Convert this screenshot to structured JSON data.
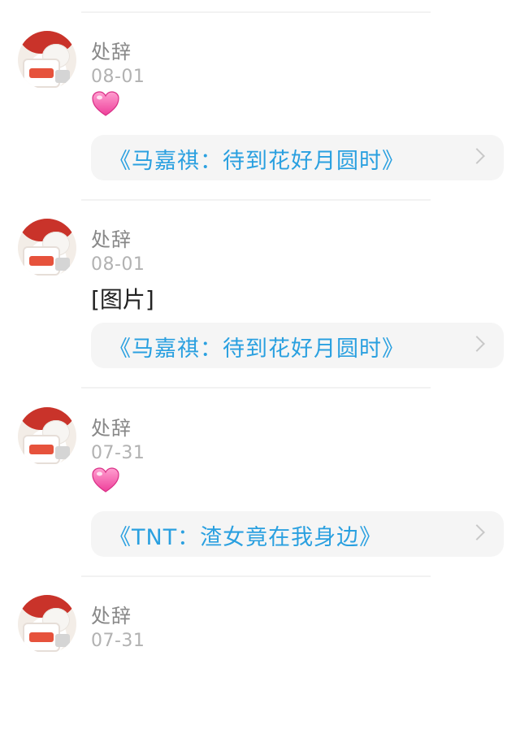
{
  "comments": [
    {
      "user": "处辞",
      "date": "08-01",
      "content_type": "heart-emoji",
      "content_text": "",
      "link": "《马嘉祺：待到花好月圆时》"
    },
    {
      "user": "处辞",
      "date": "08-01",
      "content_type": "text",
      "content_text": "[图片]",
      "link": "《马嘉祺：待到花好月圆时》"
    },
    {
      "user": "处辞",
      "date": "07-31",
      "content_type": "heart-emoji",
      "content_text": "",
      "link": "《TNT：渣女竟在我身边》"
    },
    {
      "user": "处辞",
      "date": "07-31",
      "content_type": "none",
      "content_text": "",
      "link": ""
    }
  ],
  "colors": {
    "link": "#2aa0e0",
    "username": "#888888",
    "date": "#b2b2b2",
    "card_bg": "#f5f5f5"
  },
  "icons": {
    "heart": "pink-heart-emoji",
    "chevron": "chevron-right-icon"
  }
}
